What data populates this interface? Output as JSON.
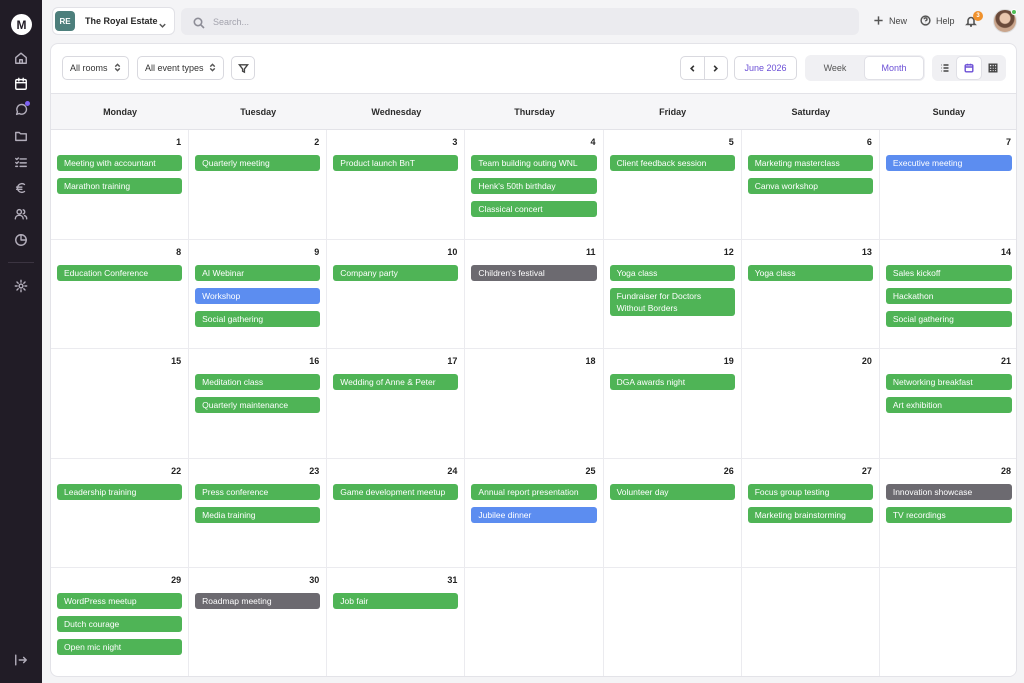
{
  "app": {
    "logo_letter": "M",
    "venue_initials": "RE",
    "venue_name": "The Royal Estate",
    "search_placeholder": "Search...",
    "new_label": "New",
    "help_label": "Help",
    "notification_count": "3"
  },
  "rail_icons": [
    "home-icon",
    "calendar-icon",
    "chat-icon",
    "folder-icon",
    "checklist-icon",
    "euro-icon",
    "users-icon",
    "chart-icon",
    "settings-icon",
    "logout-icon"
  ],
  "toolbar": {
    "rooms_label": "All rooms",
    "event_types_label": "All event types",
    "current_period": "June 2026",
    "week_label": "Week",
    "month_label": "Month",
    "active_view": "Month"
  },
  "weekdays": [
    "Monday",
    "Tuesday",
    "Wednesday",
    "Thursday",
    "Friday",
    "Saturday",
    "Sunday"
  ],
  "colors": {
    "green": "#4fb456",
    "blue": "#5c8df0",
    "gray": "#6c6a70",
    "accent": "#6b4fd6"
  },
  "days": [
    {
      "day": "1",
      "events": [
        {
          "title": "Meeting with accountant",
          "color": "green"
        },
        {
          "title": "Marathon training",
          "color": "green"
        }
      ]
    },
    {
      "day": "2",
      "events": [
        {
          "title": "Quarterly meeting",
          "color": "green"
        }
      ]
    },
    {
      "day": "3",
      "events": [
        {
          "title": "Product launch BnT",
          "color": "green"
        }
      ]
    },
    {
      "day": "4",
      "events": [
        {
          "title": "Team building outing WNL",
          "color": "green"
        },
        {
          "title": "Henk's 50th birthday",
          "color": "green"
        },
        {
          "title": "Classical concert",
          "color": "green"
        }
      ]
    },
    {
      "day": "5",
      "events": [
        {
          "title": "Client feedback session",
          "color": "green"
        }
      ]
    },
    {
      "day": "6",
      "events": [
        {
          "title": "Marketing masterclass",
          "color": "green"
        },
        {
          "title": "Canva workshop",
          "color": "green"
        }
      ]
    },
    {
      "day": "7",
      "events": [
        {
          "title": "Executive meeting",
          "color": "blue"
        }
      ]
    },
    {
      "day": "8",
      "events": [
        {
          "title": "Education Conference",
          "color": "green"
        }
      ]
    },
    {
      "day": "9",
      "events": [
        {
          "title": "AI Webinar",
          "color": "green"
        },
        {
          "title": "Workshop",
          "color": "blue"
        },
        {
          "title": "Social gathering",
          "color": "green"
        }
      ]
    },
    {
      "day": "10",
      "events": [
        {
          "title": "Company party",
          "color": "green"
        }
      ]
    },
    {
      "day": "11",
      "events": [
        {
          "title": "Children's festival",
          "color": "gray"
        }
      ]
    },
    {
      "day": "12",
      "events": [
        {
          "title": "Yoga class",
          "color": "green"
        },
        {
          "title": "Fundraiser for Doctors Without Borders",
          "color": "green"
        }
      ]
    },
    {
      "day": "13",
      "events": [
        {
          "title": "Yoga class",
          "color": "green"
        }
      ]
    },
    {
      "day": "14",
      "events": [
        {
          "title": "Sales kickoff",
          "color": "green"
        },
        {
          "title": "Hackathon",
          "color": "green"
        },
        {
          "title": "Social gathering",
          "color": "green"
        }
      ]
    },
    {
      "day": "15",
      "events": []
    },
    {
      "day": "16",
      "events": [
        {
          "title": "Meditation class",
          "color": "green"
        },
        {
          "title": "Quarterly maintenance",
          "color": "green"
        }
      ]
    },
    {
      "day": "17",
      "events": [
        {
          "title": "Wedding of Anne & Peter",
          "color": "green"
        }
      ]
    },
    {
      "day": "18",
      "events": []
    },
    {
      "day": "19",
      "events": [
        {
          "title": "DGA awards night",
          "color": "green"
        }
      ]
    },
    {
      "day": "20",
      "events": []
    },
    {
      "day": "21",
      "events": [
        {
          "title": "Networking breakfast",
          "color": "green"
        },
        {
          "title": "Art exhibition",
          "color": "green"
        }
      ]
    },
    {
      "day": "22",
      "events": [
        {
          "title": "Leadership training",
          "color": "green"
        }
      ]
    },
    {
      "day": "23",
      "events": [
        {
          "title": "Press conference",
          "color": "green"
        },
        {
          "title": "Media training",
          "color": "green"
        }
      ]
    },
    {
      "day": "24",
      "events": [
        {
          "title": "Game development meetup",
          "color": "green"
        }
      ]
    },
    {
      "day": "25",
      "events": [
        {
          "title": "Annual report presentation",
          "color": "green"
        },
        {
          "title": "Jubilee dinner",
          "color": "blue"
        }
      ]
    },
    {
      "day": "26",
      "events": [
        {
          "title": "Volunteer day",
          "color": "green"
        }
      ]
    },
    {
      "day": "27",
      "events": [
        {
          "title": "Focus group testing",
          "color": "green"
        },
        {
          "title": "Marketing brainstorming",
          "color": "green"
        }
      ]
    },
    {
      "day": "28",
      "events": [
        {
          "title": "Innovation showcase",
          "color": "gray"
        },
        {
          "title": "TV recordings",
          "color": "green"
        }
      ]
    },
    {
      "day": "29",
      "events": [
        {
          "title": "WordPress meetup",
          "color": "green"
        },
        {
          "title": "Dutch courage",
          "color": "green"
        },
        {
          "title": "Open mic night",
          "color": "green"
        }
      ]
    },
    {
      "day": "30",
      "events": [
        {
          "title": "Roadmap meeting",
          "color": "gray"
        }
      ]
    },
    {
      "day": "31",
      "events": [
        {
          "title": "Job fair",
          "color": "green"
        }
      ]
    }
  ]
}
